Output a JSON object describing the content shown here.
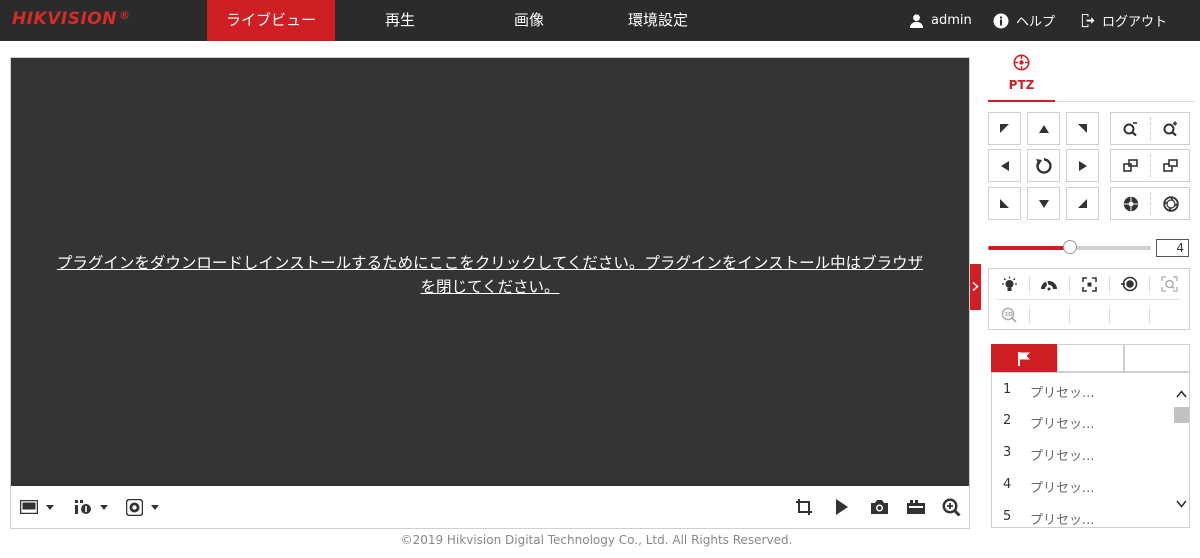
{
  "header": {
    "logo_text": "HIKVISION",
    "logo_reg": "®",
    "tabs": [
      {
        "label": "ライブビュー",
        "active": true
      },
      {
        "label": "再生",
        "active": false
      },
      {
        "label": "画像",
        "active": false
      },
      {
        "label": "環境設定",
        "active": false
      }
    ],
    "user": "admin",
    "help": "ヘルプ",
    "logout": "ログアウト"
  },
  "video": {
    "plugin_message_line1": "プラグインをダウンロードしインストールするためにここをクリックしてください。プラグインをインストール中はブラウザ",
    "plugin_message_line2": "を閉じてください。"
  },
  "ptz": {
    "tab_label": "PTZ",
    "speed_value": "4",
    "speed_level_fraction": 0.5
  },
  "presets": {
    "items": [
      {
        "num": "1",
        "name": "プリセッ..."
      },
      {
        "num": "2",
        "name": "プリセッ..."
      },
      {
        "num": "3",
        "name": "プリセッ..."
      },
      {
        "num": "4",
        "name": "プリセッ..."
      },
      {
        "num": "5",
        "name": "プリセッ..."
      }
    ]
  },
  "footer": {
    "copyright": "©2019 Hikvision Digital Technology Co., Ltd. All Rights Reserved."
  },
  "colors": {
    "accent": "#cf1f24",
    "header_bg": "#2b2b2b",
    "video_bg": "#343434"
  }
}
